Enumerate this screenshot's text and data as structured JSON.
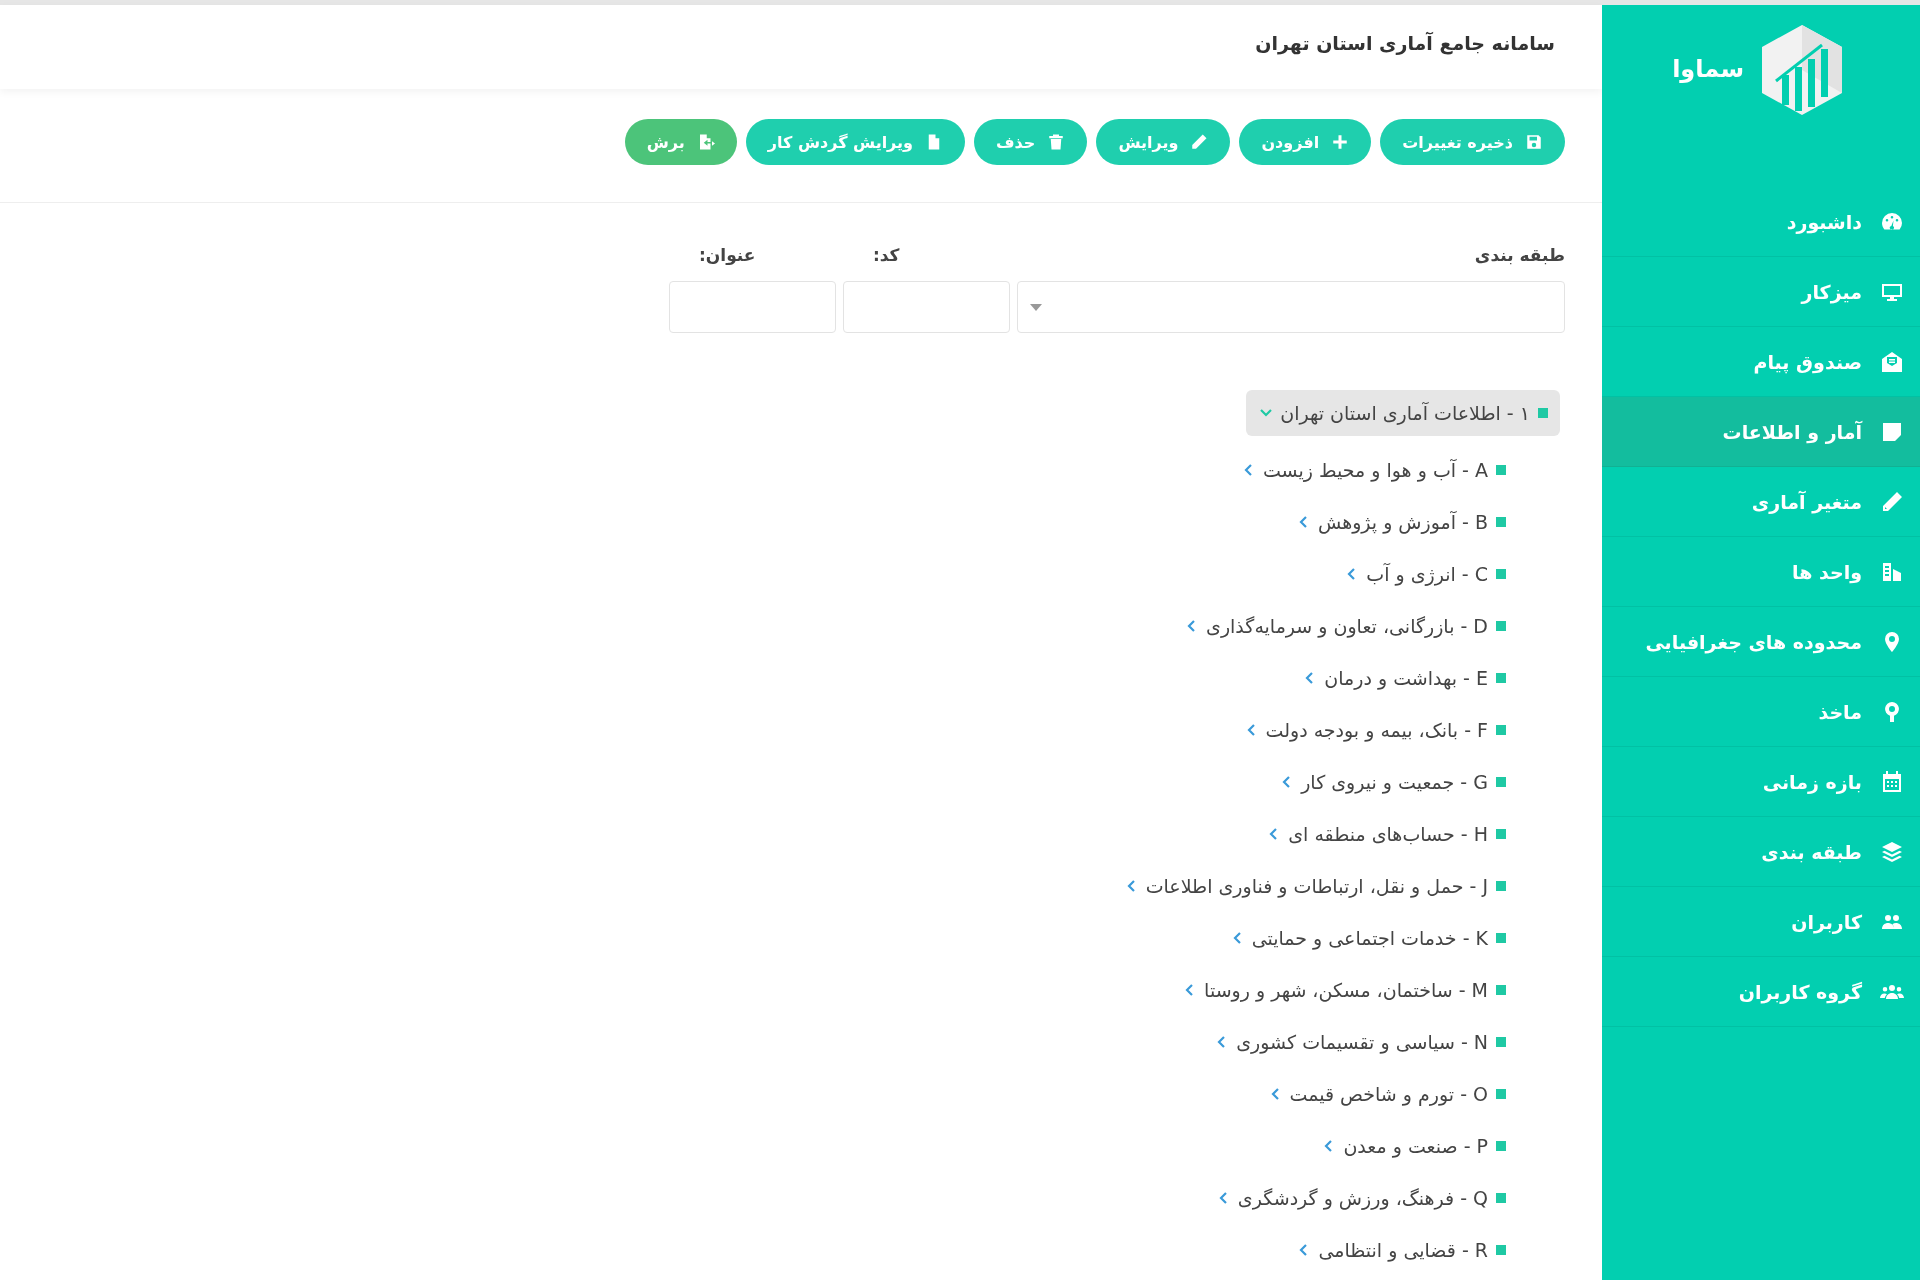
{
  "header": {
    "title": "سامانه جامع آماری استان تهران"
  },
  "sidebar": {
    "logo": "سماوا",
    "items": [
      {
        "label": "داشبورد",
        "selected": false
      },
      {
        "label": "میزکار",
        "selected": false
      },
      {
        "label": "صندوق پیام",
        "selected": false
      },
      {
        "label": "آمار و اطلاعات",
        "selected": true
      },
      {
        "label": "متغیر آماری",
        "selected": false
      },
      {
        "label": "واحد ها",
        "selected": false
      },
      {
        "label": "محدوده های جغرافیایی",
        "selected": false
      },
      {
        "label": "ماخذ",
        "selected": false
      },
      {
        "label": "بازه زمانی",
        "selected": false
      },
      {
        "label": "طبقه بندی",
        "selected": false
      },
      {
        "label": "کاربران",
        "selected": false
      },
      {
        "label": "گروه کاربران",
        "selected": false
      }
    ]
  },
  "toolbar": {
    "buttons": [
      {
        "label": "ذخیره تغییرات",
        "color": "#1fcfae"
      },
      {
        "label": "افزودن",
        "color": "#1fcfae"
      },
      {
        "label": "ویرایش",
        "color": "#1fcfae"
      },
      {
        "label": "حذف",
        "color": "#1fcfae"
      },
      {
        "label": "ویرایش گردش کار",
        "color": "#1fcfae"
      },
      {
        "label": "برش",
        "color": "#4cc47a"
      }
    ]
  },
  "form": {
    "fields": [
      {
        "label": "طبقه بندی",
        "kind": "select"
      },
      {
        "label": "کد:",
        "kind": "text"
      },
      {
        "label": "عنوان:",
        "kind": "text"
      }
    ]
  },
  "tree": [
    {
      "label": "۱ - اطلاعات آماری استان تهران",
      "selected": true,
      "expanded": true,
      "children": [
        {
          "label": "A - آب و هوا و محیط زیست",
          "selected": false,
          "expanded": false
        },
        {
          "label": "B - آموزش و پژوهش",
          "selected": false,
          "expanded": false
        },
        {
          "label": "C - انرژی و آب",
          "selected": false,
          "expanded": false
        },
        {
          "label": "D - بازرگانی، تعاون و سرمایه‌گذاری",
          "selected": false,
          "expanded": false
        },
        {
          "label": "E - بهداشت و درمان",
          "selected": false,
          "expanded": false
        },
        {
          "label": "F - بانک، بیمه و بودجه دولت",
          "selected": false,
          "expanded": false
        },
        {
          "label": "G - جمعیت و نیروی کار",
          "selected": false,
          "expanded": false
        },
        {
          "label": "H - حساب‌های منطقه ای",
          "selected": false,
          "expanded": false
        },
        {
          "label": "J - حمل و نقل، ارتباطات و فناوری اطلاعات",
          "selected": false,
          "expanded": false
        },
        {
          "label": "K - خدمات اجتماعی و حمایتی",
          "selected": false,
          "expanded": false
        },
        {
          "label": "M - ساختمان، مسکن، شهر و روستا",
          "selected": false,
          "expanded": false
        },
        {
          "label": "N - سیاسی و تقسیمات کشوری",
          "selected": false,
          "expanded": false
        },
        {
          "label": "O - تورم و شاخص قیمت",
          "selected": false,
          "expanded": false
        },
        {
          "label": "P - صنعت و معدن",
          "selected": false,
          "expanded": false
        },
        {
          "label": "Q - فرهنگ، ورزش و گردشگری",
          "selected": false,
          "expanded": false
        },
        {
          "label": "R - قضایی و انتظامی",
          "selected": false,
          "expanded": false
        }
      ]
    }
  ]
}
